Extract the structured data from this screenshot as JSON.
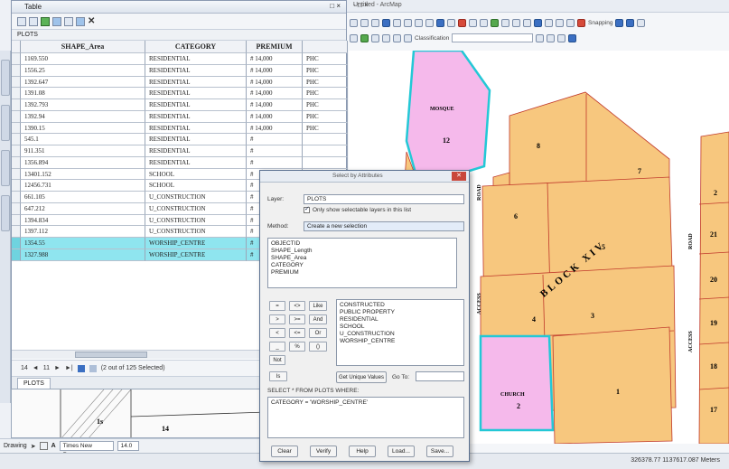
{
  "table": {
    "title": "Table",
    "close": "□ ×",
    "toolbar_icons": [
      "table-options-icon",
      "related-tables-icon",
      "select-by-attributes-icon",
      "switch-selection-icon",
      "clear-selection-icon",
      "zoom-to-selected-icon",
      "delete-selected-icon"
    ],
    "layer_name": "PLOTS",
    "columns": [
      "SHAPE_Area",
      "CATEGORY",
      "PREMIUM",
      ""
    ],
    "rows": [
      {
        "area": "1169.550",
        "category": "RESIDENTIAL",
        "premium": "# 14,000",
        "extra": "PHC",
        "selected": false
      },
      {
        "area": "1556.25",
        "category": "RESIDENTIAL",
        "premium": "# 14,000",
        "extra": "PHC",
        "selected": false
      },
      {
        "area": "1392.647",
        "category": "RESIDENTIAL",
        "premium": "# 14,000",
        "extra": "PHC",
        "selected": false
      },
      {
        "area": "1391.08",
        "category": "RESIDENTIAL",
        "premium": "# 14,000",
        "extra": "PHC",
        "selected": false
      },
      {
        "area": "1392.793",
        "category": "RESIDENTIAL",
        "premium": "# 14,000",
        "extra": "PHC",
        "selected": false
      },
      {
        "area": "1392.94",
        "category": "RESIDENTIAL",
        "premium": "# 14,000",
        "extra": "PHC",
        "selected": false
      },
      {
        "area": "1390.15",
        "category": "RESIDENTIAL",
        "premium": "# 14,000",
        "extra": "PHC",
        "selected": false
      },
      {
        "area": "545.1",
        "category": "RESIDENTIAL",
        "premium": "#",
        "extra": "",
        "selected": false
      },
      {
        "area": "911.351",
        "category": "RESIDENTIAL",
        "premium": "#",
        "extra": "",
        "selected": false
      },
      {
        "area": "1356.894",
        "category": "RESIDENTIAL",
        "premium": "#",
        "extra": "",
        "selected": false
      },
      {
        "area": "13401.152",
        "category": "SCHOOL",
        "premium": "#",
        "extra": "",
        "selected": false
      },
      {
        "area": "12456.731",
        "category": "SCHOOL",
        "premium": "#",
        "extra": "",
        "selected": false
      },
      {
        "area": "661.105",
        "category": "U_CONSTRUCTION",
        "premium": "#",
        "extra": "",
        "selected": false
      },
      {
        "area": "647.212",
        "category": "U_CONSTRUCTION",
        "premium": "#",
        "extra": "",
        "selected": false
      },
      {
        "area": "1394.834",
        "category": "U_CONSTRUCTION",
        "premium": "#",
        "extra": "",
        "selected": false
      },
      {
        "area": "1397.112",
        "category": "U_CONSTRUCTION",
        "premium": "#",
        "extra": "",
        "selected": false
      },
      {
        "area": "1354.55",
        "category": "WORSHIP_CENTRE",
        "premium": "#",
        "extra": "",
        "selected": true
      },
      {
        "area": "1327.988",
        "category": "WORSHIP_CENTRE",
        "premium": "#",
        "extra": "",
        "selected": true
      }
    ],
    "nav": {
      "first": "14",
      "prev": "◄",
      "record": "11",
      "next": "►",
      "last": "►|",
      "status": "(2 out of 125 Selected)"
    },
    "bottom_tab": "PLOTS"
  },
  "main_window": {
    "title": "Untitled - ArcMap",
    "controls": "- □ ×",
    "snapping_label": "Snapping",
    "classification_label": "Classification"
  },
  "dialog": {
    "title": "Select by Attributes",
    "layer_label": "Layer:",
    "layer_value": "PLOTS",
    "only_selectable": "Only show selectable layers in this list",
    "method_label": "Method:",
    "method_value": "Create a new selection",
    "fields": [
      "OBJECTID",
      "SHAPE_Length",
      "SHAPE_Area",
      "CATEGORY",
      "PREMIUM"
    ],
    "values": [
      "CONSTRUCTED",
      "PUBLIC PROPERTY",
      "RESIDENTIAL",
      "SCHOOL",
      "U_CONSTRUCTION",
      "WORSHIP_CENTRE"
    ],
    "ops": [
      "=",
      "<>",
      "Like",
      ">",
      ">=",
      "And",
      "<",
      "<=",
      "Or",
      "_",
      "%",
      "()",
      "Not",
      "Is"
    ],
    "get_unique": "Get Unique Values",
    "goto": "Go To:",
    "sql_prefix": "SELECT * FROM PLOTS WHERE:",
    "expression": "CATEGORY = 'WORSHIP_CENTRE'",
    "buttons": [
      "Clear",
      "Verify",
      "Help",
      "Load...",
      "Save..."
    ]
  },
  "map": {
    "labels": {
      "mosque": "MOSQUE",
      "church": "CHURCH",
      "block": "BLOCK XIV",
      "access1": "ACCESS",
      "road1": "ROAD",
      "access2": "ACCESS",
      "road2": "ROAD",
      "p12": "12",
      "p2": "2",
      "p8": "8",
      "p7": "7",
      "p6": "6",
      "p5": "5",
      "p4": "4",
      "p3": "3",
      "p1": "1",
      "p21": "21",
      "p20": "20",
      "p19": "19",
      "p18": "18",
      "p17": "17",
      "p2b": "2"
    },
    "colors": {
      "plot": "#f7c77e",
      "worship": "#f5b9eb",
      "outline": "#c0392b",
      "selected": "#23c8d6"
    }
  },
  "layout_labels": {
    "a": "1s",
    "b": "14"
  },
  "drawing_bar": {
    "drawing": "Drawing",
    "font": "Times New Roman",
    "size": "14.0"
  },
  "status": {
    "coords": "326378.77  1137617.087 Meters"
  }
}
